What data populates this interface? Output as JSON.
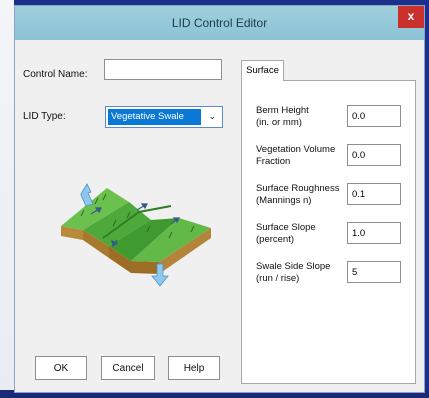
{
  "window": {
    "title": "LID Control Editor",
    "close_glyph": "x"
  },
  "control_name": {
    "label": "Control Name:",
    "value": ""
  },
  "lid_type": {
    "label": "LID Type:",
    "selected": "Vegetative Swale",
    "arrow_glyph": "⌄"
  },
  "illustration": {
    "icon": "vegetative-swale-icon"
  },
  "tab": {
    "label": "Surface"
  },
  "fields": [
    {
      "label_line1": "Berm Height",
      "label_line2": "(in. or mm)",
      "value": "0.0"
    },
    {
      "label_line1": "Vegetation Volume",
      "label_line2": "Fraction",
      "value": "0.0"
    },
    {
      "label_line1": "Surface Roughness",
      "label_line2": "(Mannings n)",
      "value": "0.1"
    },
    {
      "label_line1": "Surface Slope",
      "label_line2": "(percent)",
      "value": "1.0"
    },
    {
      "label_line1": "Swale Side Slope",
      "label_line2": "(run / rise)",
      "value": "5"
    }
  ],
  "buttons": {
    "ok": "OK",
    "cancel": "Cancel",
    "help": "Help"
  },
  "colors": {
    "titlebar": "#94c9d9",
    "close": "#c9302c",
    "selection": "#0a78d7",
    "swale_green": "#5cb84a"
  }
}
